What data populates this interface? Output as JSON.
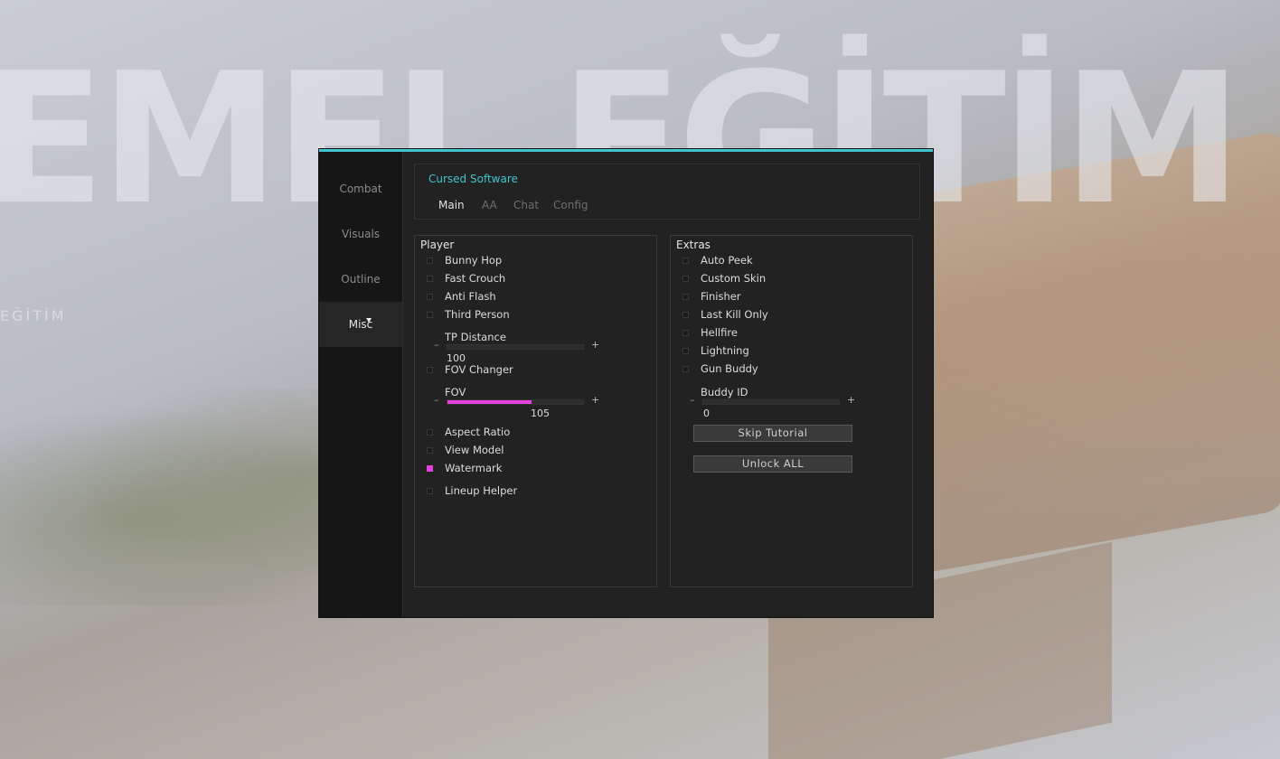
{
  "background": {
    "title_text": "EMEL EĞİTİM",
    "subtitle_text": "EĞİTİM"
  },
  "colors": {
    "accent": "#3fc6cf",
    "toggle_on": "#e540e0",
    "panel_bg": "#222222",
    "sidebar_bg": "#161616"
  },
  "sidebar": {
    "items": [
      {
        "label": "Combat",
        "active": false
      },
      {
        "label": "Visuals",
        "active": false
      },
      {
        "label": "Outline",
        "active": false
      },
      {
        "label": "Misc",
        "active": true
      }
    ]
  },
  "header": {
    "brand": "Cursed Software",
    "tabs": [
      {
        "label": "Main",
        "active": true
      },
      {
        "label": "AA",
        "active": false
      },
      {
        "label": "Chat",
        "active": false
      },
      {
        "label": "Config",
        "active": false
      }
    ]
  },
  "player": {
    "title": "Player",
    "bunny_hop": {
      "label": "Bunny Hop",
      "checked": false
    },
    "fast_crouch": {
      "label": "Fast Crouch",
      "checked": false
    },
    "anti_flash": {
      "label": "Anti Flash",
      "checked": false
    },
    "third_person": {
      "label": "Third Person",
      "checked": false
    },
    "tp_distance": {
      "label": "TP Distance",
      "value": "100",
      "fill_fraction": 0,
      "minus": "–",
      "plus": "+"
    },
    "fov_changer": {
      "label": "FOV Changer",
      "checked": false
    },
    "fov": {
      "label": "FOV",
      "value": "105",
      "fill_fraction": 0.62,
      "minus": "–",
      "plus": "+"
    },
    "aspect_ratio": {
      "label": "Aspect Ratio",
      "checked": false
    },
    "view_model": {
      "label": "View Model",
      "checked": false
    },
    "watermark": {
      "label": "Watermark",
      "checked": true
    },
    "lineup_helper": {
      "label": "Lineup Helper",
      "checked": false
    }
  },
  "extras": {
    "title": "Extras",
    "auto_peek": {
      "label": "Auto Peek",
      "checked": false
    },
    "custom_skin": {
      "label": "Custom Skin",
      "checked": false
    },
    "finisher": {
      "label": "Finisher",
      "checked": false
    },
    "last_kill_only": {
      "label": "Last Kill Only",
      "checked": false
    },
    "hellfire": {
      "label": "Hellfire",
      "checked": false
    },
    "lightning": {
      "label": "Lightning",
      "checked": false
    },
    "gun_buddy": {
      "label": "Gun Buddy",
      "checked": false
    },
    "buddy_id": {
      "label": "Buddy ID",
      "value": "0",
      "fill_fraction": 0,
      "minus": "–",
      "plus": "+"
    },
    "skip_tutorial": "Skip Tutorial",
    "unlock_all": "Unlock ALL"
  }
}
